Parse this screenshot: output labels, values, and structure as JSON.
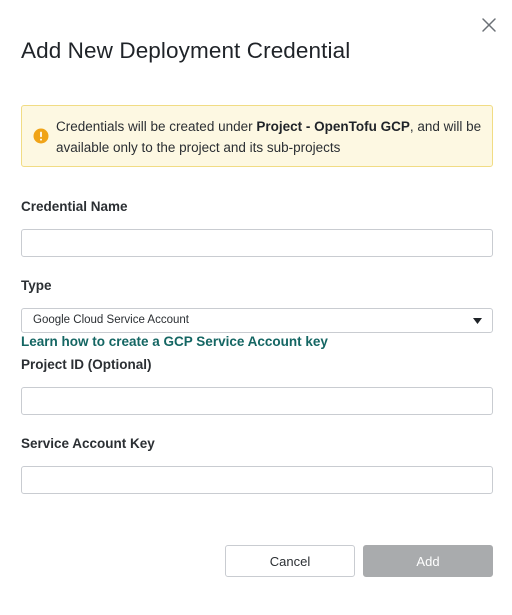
{
  "dialog": {
    "title": "Add New Deployment Credential"
  },
  "alert": {
    "text_before": "Credentials will be created under ",
    "project_name": "Project - OpenTofu GCP",
    "text_after": ", and will be available only to the project and its sub-projects",
    "icon": "warning-circle-icon",
    "background": "#fdf8e2",
    "icon_color": "#f0a418"
  },
  "fields": {
    "credential_name": {
      "label": "Credential Name",
      "value": ""
    },
    "type": {
      "label": "Type",
      "selected": "Google Cloud Service Account",
      "help_link": "Learn how to create a GCP Service Account key"
    },
    "project_id": {
      "label": "Project ID (Optional)",
      "value": ""
    },
    "service_account_key": {
      "label": "Service Account Key",
      "value": ""
    }
  },
  "actions": {
    "cancel_label": "Cancel",
    "add_label": "Add",
    "add_disabled": true
  },
  "colors": {
    "link": "#146663",
    "disabled_button": "#a9abad"
  }
}
